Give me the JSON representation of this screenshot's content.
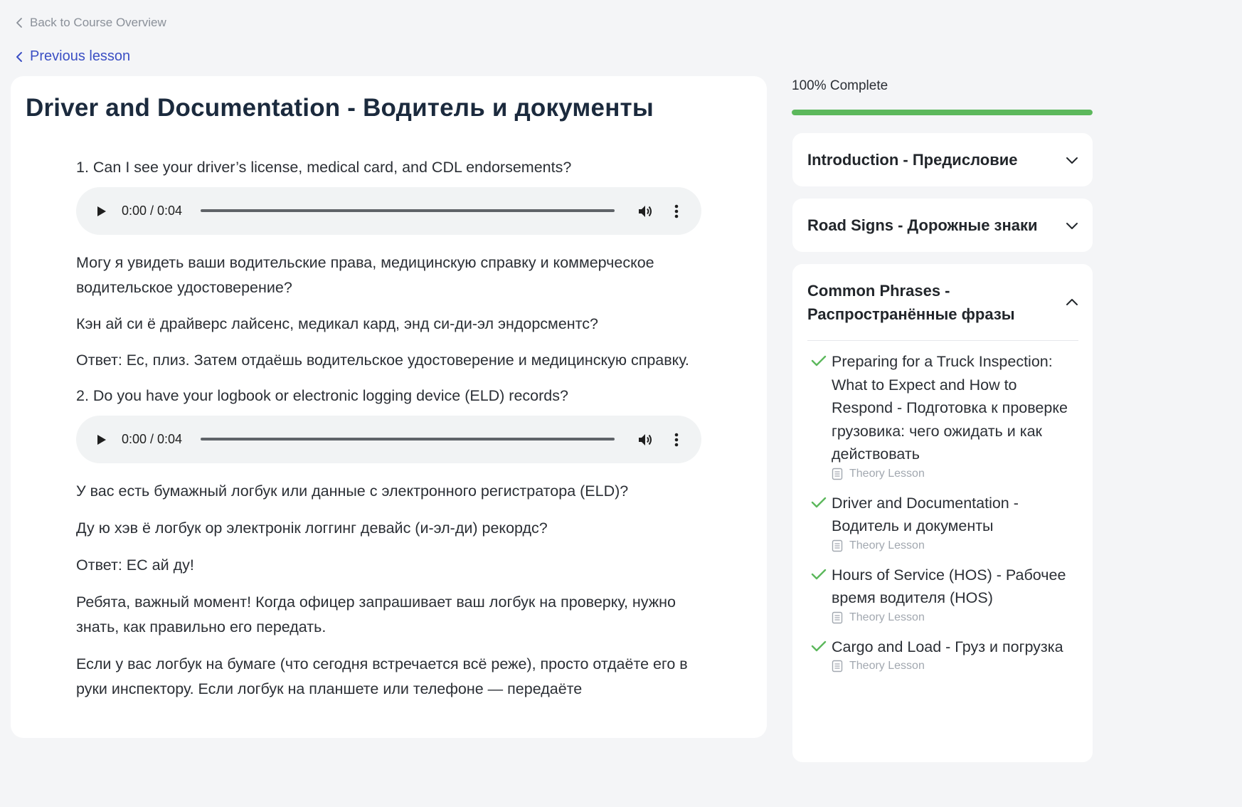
{
  "nav": {
    "back_label": "Back to Course Overview",
    "previous_label": "Previous lesson"
  },
  "lesson": {
    "title": "Driver and Documentation - Водитель и документы",
    "blocks": [
      {
        "type": "question",
        "text": "1. Can I see your driver’s license, medical card, and CDL endorsements?"
      },
      {
        "type": "audio",
        "time": "0:00 / 0:04"
      },
      {
        "type": "para",
        "text": "Могу я увидеть ваши водительские права, медицинскую справку и коммерческое водительское удостоверение?"
      },
      {
        "type": "para",
        "text": "Кэн ай си ё драйверс лайсенс, медикал кард, энд си-ди-эл эндорсментс?"
      },
      {
        "type": "para",
        "text": "Ответ: Ес, плиз. Затем отдаёшь водительское удостоверение и медицинскую справку."
      },
      {
        "type": "question",
        "text": "2. Do you have your logbook or electronic logging device (ELD) records?"
      },
      {
        "type": "audio",
        "time": "0:00 / 0:04"
      },
      {
        "type": "para",
        "text": "У вас есть бумажный логбук или данные с электронного регистратора (ELD)?"
      },
      {
        "type": "para",
        "text": "Ду ю хэв ё логбук ор электронік логгинг девайс (и-эл-ди) рекордс?"
      },
      {
        "type": "para",
        "text": "Ответ: ЕС ай ду!"
      },
      {
        "type": "para",
        "text": "Ребята, важный момент! Когда офицер запрашивает ваш логбук на проверку, нужно знать, как правильно его передать."
      },
      {
        "type": "para",
        "text": "Если у вас логбук на бумаге (что сегодня встречается всё реже), просто отдаёте его в руки инспектору. Если логбук на планшете или телефоне — передаёте"
      }
    ]
  },
  "sidebar": {
    "progress_label": "100% Complete",
    "progress_value": 1.0,
    "sections": [
      {
        "title": "Introduction - Предисловие",
        "expanded": false
      },
      {
        "title": "Road Signs - Дорожные знаки",
        "expanded": false
      },
      {
        "title": "Common Phrases - Распространённые фразы",
        "expanded": true
      }
    ],
    "lessons": [
      {
        "name": "Preparing for a Truck Inspection: What to Expect and How to Respond - Подготовка к проверке грузовика: чего ожидать и как действовать",
        "meta": "Theory Lesson"
      },
      {
        "name": "Driver and Documentation - Водитель и документы",
        "meta": "Theory Lesson"
      },
      {
        "name": "Hours of Service (HOS) - Рабочее время водителя (HOS)",
        "meta": "Theory Lesson"
      },
      {
        "name": "Cargo and Load - Груз и погрузка",
        "meta": "Theory Lesson"
      }
    ]
  },
  "colors": {
    "accent_link": "#3b4fc4",
    "progress": "#5cb85c",
    "check": "#5cb85c"
  }
}
